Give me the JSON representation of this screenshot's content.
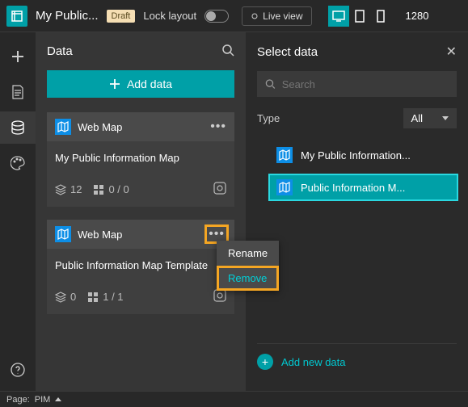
{
  "header": {
    "title": "My Public...",
    "draft_badge": "Draft",
    "lock_label": "Lock layout",
    "live_view": "Live view",
    "zoom": "1280"
  },
  "data_panel": {
    "title": "Data",
    "add_button": "Add data",
    "cards": [
      {
        "type_label": "Web Map",
        "title": "My Public Information Map",
        "layers": "12",
        "widgets": "0 / 0"
      },
      {
        "type_label": "Web Map",
        "title": "Public Information Map Template",
        "layers": "0",
        "widgets": "1 / 1"
      }
    ]
  },
  "context_menu": {
    "rename": "Rename",
    "remove": "Remove"
  },
  "select_panel": {
    "title": "Select data",
    "search_placeholder": "Search",
    "type_label": "Type",
    "type_value": "All",
    "results": [
      "My Public Information...",
      "Public Information M..."
    ],
    "add_new": "Add new data"
  },
  "footer": {
    "page_label": "Page:",
    "page_value": "PIM"
  }
}
